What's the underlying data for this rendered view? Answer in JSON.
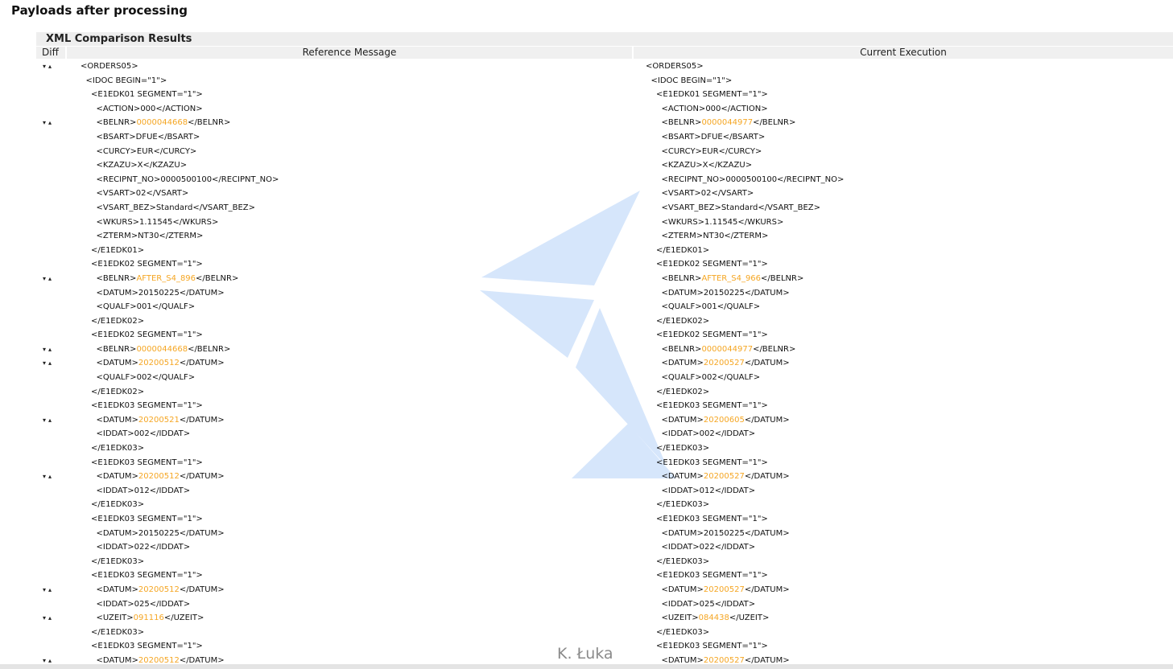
{
  "page": {
    "title": "Payloads after processing"
  },
  "panel": {
    "title": "XML Comparison Results",
    "columns": {
      "diff": "Diff",
      "reference": "Reference Message",
      "current": "Current Execution"
    }
  },
  "diff_marker": "▾▴",
  "credit": "K. Łuka",
  "colors": {
    "highlight": "#f5a623",
    "watermark": "#d6e6fb"
  },
  "rows": [
    {
      "indent": 0,
      "diff": true,
      "ref": [
        "<ORDERS05>"
      ],
      "cur": [
        "<ORDERS05>"
      ]
    },
    {
      "indent": 1,
      "diff": false,
      "ref": [
        "<IDOC BEGIN=\"1\">"
      ],
      "cur": [
        "<IDOC BEGIN=\"1\">"
      ]
    },
    {
      "indent": 2,
      "diff": false,
      "ref": [
        "<E1EDK01 SEGMENT=\"1\">"
      ],
      "cur": [
        "<E1EDK01 SEGMENT=\"1\">"
      ]
    },
    {
      "indent": 3,
      "diff": false,
      "ref": [
        "<ACTION>000</ACTION>"
      ],
      "cur": [
        "<ACTION>000</ACTION>"
      ]
    },
    {
      "indent": 3,
      "diff": true,
      "ref": [
        "<BELNR>",
        "0000044668",
        "</BELNR>"
      ],
      "cur": [
        "<BELNR>",
        "0000044977",
        "</BELNR>"
      ]
    },
    {
      "indent": 3,
      "diff": false,
      "ref": [
        "<BSART>DFUE</BSART>"
      ],
      "cur": [
        "<BSART>DFUE</BSART>"
      ]
    },
    {
      "indent": 3,
      "diff": false,
      "ref": [
        "<CURCY>EUR</CURCY>"
      ],
      "cur": [
        "<CURCY>EUR</CURCY>"
      ]
    },
    {
      "indent": 3,
      "diff": false,
      "ref": [
        "<KZAZU>X</KZAZU>"
      ],
      "cur": [
        "<KZAZU>X</KZAZU>"
      ]
    },
    {
      "indent": 3,
      "diff": false,
      "ref": [
        "<RECIPNT_NO>0000500100</RECIPNT_NO>"
      ],
      "cur": [
        "<RECIPNT_NO>0000500100</RECIPNT_NO>"
      ]
    },
    {
      "indent": 3,
      "diff": false,
      "ref": [
        "<VSART>02</VSART>"
      ],
      "cur": [
        "<VSART>02</VSART>"
      ]
    },
    {
      "indent": 3,
      "diff": false,
      "ref": [
        "<VSART_BEZ>Standard</VSART_BEZ>"
      ],
      "cur": [
        "<VSART_BEZ>Standard</VSART_BEZ>"
      ]
    },
    {
      "indent": 3,
      "diff": false,
      "ref": [
        "<WKURS>1.11545</WKURS>"
      ],
      "cur": [
        "<WKURS>1.11545</WKURS>"
      ]
    },
    {
      "indent": 3,
      "diff": false,
      "ref": [
        "<ZTERM>NT30</ZTERM>"
      ],
      "cur": [
        "<ZTERM>NT30</ZTERM>"
      ]
    },
    {
      "indent": 2,
      "diff": false,
      "ref": [
        "</E1EDK01>"
      ],
      "cur": [
        "</E1EDK01>"
      ]
    },
    {
      "indent": 2,
      "diff": false,
      "ref": [
        "<E1EDK02 SEGMENT=\"1\">"
      ],
      "cur": [
        "<E1EDK02 SEGMENT=\"1\">"
      ]
    },
    {
      "indent": 3,
      "diff": true,
      "ref": [
        "<BELNR>",
        "AFTER_S4_896",
        "</BELNR>"
      ],
      "cur": [
        "<BELNR>",
        "AFTER_S4_966",
        "</BELNR>"
      ]
    },
    {
      "indent": 3,
      "diff": false,
      "ref": [
        "<DATUM>20150225</DATUM>"
      ],
      "cur": [
        "<DATUM>20150225</DATUM>"
      ]
    },
    {
      "indent": 3,
      "diff": false,
      "ref": [
        "<QUALF>001</QUALF>"
      ],
      "cur": [
        "<QUALF>001</QUALF>"
      ]
    },
    {
      "indent": 2,
      "diff": false,
      "ref": [
        "</E1EDK02>"
      ],
      "cur": [
        "</E1EDK02>"
      ]
    },
    {
      "indent": 2,
      "diff": false,
      "ref": [
        "<E1EDK02 SEGMENT=\"1\">"
      ],
      "cur": [
        "<E1EDK02 SEGMENT=\"1\">"
      ]
    },
    {
      "indent": 3,
      "diff": true,
      "ref": [
        "<BELNR>",
        "0000044668",
        "</BELNR>"
      ],
      "cur": [
        "<BELNR>",
        "0000044977",
        "</BELNR>"
      ]
    },
    {
      "indent": 3,
      "diff": true,
      "ref": [
        "<DATUM>",
        "20200512",
        "</DATUM>"
      ],
      "cur": [
        "<DATUM>",
        "20200527",
        "</DATUM>"
      ]
    },
    {
      "indent": 3,
      "diff": false,
      "ref": [
        "<QUALF>002</QUALF>"
      ],
      "cur": [
        "<QUALF>002</QUALF>"
      ]
    },
    {
      "indent": 2,
      "diff": false,
      "ref": [
        "</E1EDK02>"
      ],
      "cur": [
        "</E1EDK02>"
      ]
    },
    {
      "indent": 2,
      "diff": false,
      "ref": [
        "<E1EDK03 SEGMENT=\"1\">"
      ],
      "cur": [
        "<E1EDK03 SEGMENT=\"1\">"
      ]
    },
    {
      "indent": 3,
      "diff": true,
      "ref": [
        "<DATUM>",
        "20200521",
        "</DATUM>"
      ],
      "cur": [
        "<DATUM>",
        "20200605",
        "</DATUM>"
      ]
    },
    {
      "indent": 3,
      "diff": false,
      "ref": [
        "<IDDAT>002</IDDAT>"
      ],
      "cur": [
        "<IDDAT>002</IDDAT>"
      ]
    },
    {
      "indent": 2,
      "diff": false,
      "ref": [
        "</E1EDK03>"
      ],
      "cur": [
        "</E1EDK03>"
      ]
    },
    {
      "indent": 2,
      "diff": false,
      "ref": [
        "<E1EDK03 SEGMENT=\"1\">"
      ],
      "cur": [
        "<E1EDK03 SEGMENT=\"1\">"
      ]
    },
    {
      "indent": 3,
      "diff": true,
      "ref": [
        "<DATUM>",
        "20200512",
        "</DATUM>"
      ],
      "cur": [
        "<DATUM>",
        "20200527",
        "</DATUM>"
      ]
    },
    {
      "indent": 3,
      "diff": false,
      "ref": [
        "<IDDAT>012</IDDAT>"
      ],
      "cur": [
        "<IDDAT>012</IDDAT>"
      ]
    },
    {
      "indent": 2,
      "diff": false,
      "ref": [
        "</E1EDK03>"
      ],
      "cur": [
        "</E1EDK03>"
      ]
    },
    {
      "indent": 2,
      "diff": false,
      "ref": [
        "<E1EDK03 SEGMENT=\"1\">"
      ],
      "cur": [
        "<E1EDK03 SEGMENT=\"1\">"
      ]
    },
    {
      "indent": 3,
      "diff": false,
      "ref": [
        "<DATUM>20150225</DATUM>"
      ],
      "cur": [
        "<DATUM>20150225</DATUM>"
      ]
    },
    {
      "indent": 3,
      "diff": false,
      "ref": [
        "<IDDAT>022</IDDAT>"
      ],
      "cur": [
        "<IDDAT>022</IDDAT>"
      ]
    },
    {
      "indent": 2,
      "diff": false,
      "ref": [
        "</E1EDK03>"
      ],
      "cur": [
        "</E1EDK03>"
      ]
    },
    {
      "indent": 2,
      "diff": false,
      "ref": [
        "<E1EDK03 SEGMENT=\"1\">"
      ],
      "cur": [
        "<E1EDK03 SEGMENT=\"1\">"
      ]
    },
    {
      "indent": 3,
      "diff": true,
      "ref": [
        "<DATUM>",
        "20200512",
        "</DATUM>"
      ],
      "cur": [
        "<DATUM>",
        "20200527",
        "</DATUM>"
      ]
    },
    {
      "indent": 3,
      "diff": false,
      "ref": [
        "<IDDAT>025</IDDAT>"
      ],
      "cur": [
        "<IDDAT>025</IDDAT>"
      ]
    },
    {
      "indent": 3,
      "diff": true,
      "ref": [
        "<UZEIT>",
        "091116",
        "</UZEIT>"
      ],
      "cur": [
        "<UZEIT>",
        "084438",
        "</UZEIT>"
      ]
    },
    {
      "indent": 2,
      "diff": false,
      "ref": [
        "</E1EDK03>"
      ],
      "cur": [
        "</E1EDK03>"
      ]
    },
    {
      "indent": 2,
      "diff": false,
      "ref": [
        "<E1EDK03 SEGMENT=\"1\">"
      ],
      "cur": [
        "<E1EDK03 SEGMENT=\"1\">"
      ]
    },
    {
      "indent": 3,
      "diff": true,
      "ref": [
        "<DATUM>",
        "20200512",
        "</DATUM>"
      ],
      "cur": [
        "<DATUM>",
        "20200527",
        "</DATUM>"
      ]
    }
  ]
}
